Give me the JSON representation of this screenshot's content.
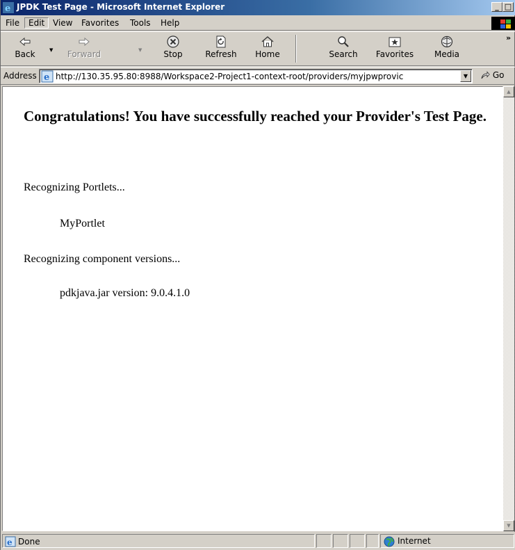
{
  "window": {
    "title": "JPDK Test Page - Microsoft Internet Explorer"
  },
  "menu": {
    "items": [
      "File",
      "Edit",
      "View",
      "Favorites",
      "Tools",
      "Help"
    ]
  },
  "toolbar": {
    "back": "Back",
    "forward": "Forward",
    "stop": "Stop",
    "refresh": "Refresh",
    "home": "Home",
    "search": "Search",
    "favorites": "Favorites",
    "media": "Media"
  },
  "address": {
    "label": "Address",
    "url": "http://130.35.95.80:8988/Workspace2-Project1-context-root/providers/myjpwprovic",
    "go": "Go"
  },
  "page": {
    "heading": "Congratulations! You have successfully reached your Provider's Test Page.",
    "recognizing_portlets": "Recognizing Portlets...",
    "portlet_name": "MyPortlet",
    "recognizing_components": "Recognizing component versions...",
    "component_version": "pdkjava.jar version: 9.0.4.1.0"
  },
  "status": {
    "text": "Done",
    "zone": "Internet"
  },
  "colors": {
    "title_gradient_start": "#0a246a",
    "title_gradient_end": "#a6caf0",
    "chrome": "#d4d0c8"
  }
}
